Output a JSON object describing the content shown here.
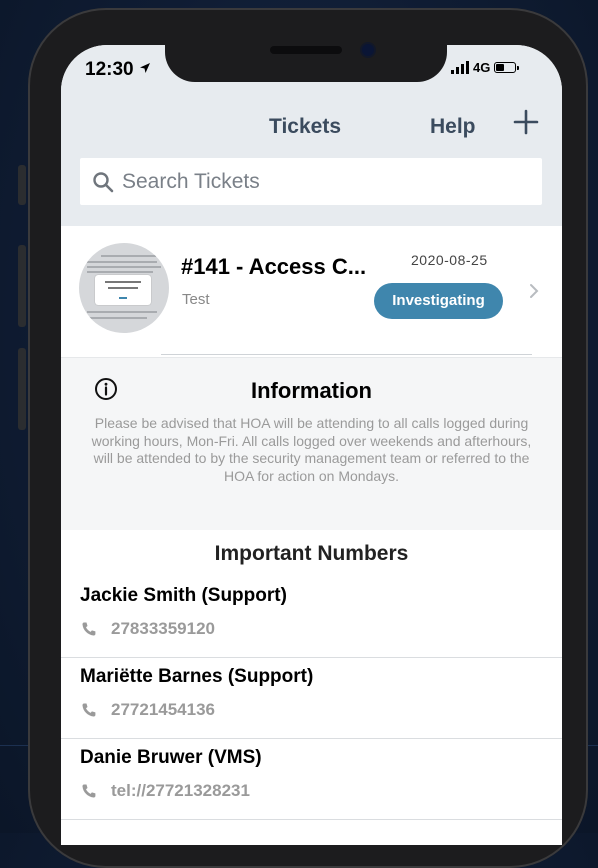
{
  "status_bar": {
    "time": "12:30",
    "network": "4G"
  },
  "nav": {
    "title": "Tickets",
    "help": "Help"
  },
  "search": {
    "placeholder": "Search Tickets"
  },
  "ticket": {
    "title": "#141 - Access C...",
    "date": "2020-08-25",
    "subtitle": "Test",
    "status": "Investigating"
  },
  "info": {
    "title": "Information",
    "body": "Please be advised that HOA will be attending to all calls logged during working hours, Mon-Fri. All calls  logged over weekends and afterhours, will be attended to by the security management team or referred to the HOA for action on Mondays."
  },
  "numbers": {
    "title": "Important Numbers",
    "contacts": [
      {
        "name": "Jackie Smith (Support)",
        "phone": "27833359120"
      },
      {
        "name": "Mariëtte Barnes (Support)",
        "phone": "27721454136"
      },
      {
        "name": "Danie Bruwer (VMS)",
        "phone": "tel://27721328231"
      }
    ]
  },
  "colors": {
    "accent": "#3f86ad",
    "nav_text": "#3b4b5e",
    "header_bg": "#e7ebef"
  },
  "icons": [
    "location-arrow-icon",
    "signal-icon",
    "battery-icon",
    "plus-icon",
    "search-icon",
    "chevron-right-icon",
    "info-icon",
    "phone-icon"
  ]
}
